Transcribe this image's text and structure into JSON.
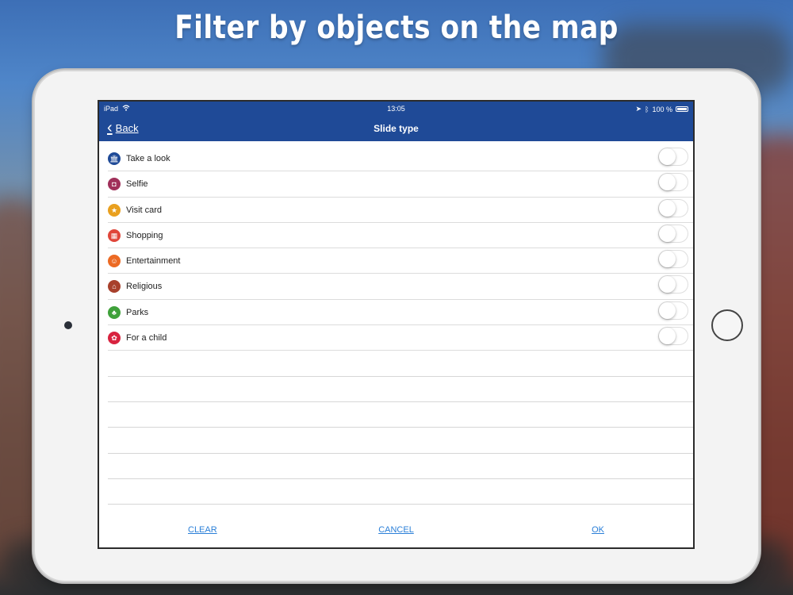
{
  "headline": "Filter by objects on the map",
  "status": {
    "device": "iPad",
    "time": "13:05",
    "battery": "100 %"
  },
  "navbar": {
    "back_label": "Back",
    "title": "Slide type"
  },
  "items": [
    {
      "label": "Take a look",
      "icon": "museum-icon",
      "color": "#1f4a97",
      "glyph": "🏛",
      "on": false
    },
    {
      "label": "Selfie",
      "icon": "camera-icon",
      "color": "#a0305a",
      "glyph": "◘",
      "on": false
    },
    {
      "label": "Visit card",
      "icon": "star-icon",
      "color": "#e9a01f",
      "glyph": "★",
      "on": false
    },
    {
      "label": "Shopping",
      "icon": "shopping-cart-icon",
      "color": "#e0463a",
      "glyph": "▦",
      "on": false
    },
    {
      "label": "Entertainment",
      "icon": "smiley-icon",
      "color": "#ec6a24",
      "glyph": "☺",
      "on": false
    },
    {
      "label": "Religious",
      "icon": "church-icon",
      "color": "#a8402c",
      "glyph": "⌂",
      "on": false
    },
    {
      "label": "Parks",
      "icon": "tree-icon",
      "color": "#3fa13a",
      "glyph": "♣",
      "on": false
    },
    {
      "label": "For a child",
      "icon": "duck-icon",
      "color": "#d8233f",
      "glyph": "✿",
      "on": false
    }
  ],
  "footer": {
    "clear": "CLEAR",
    "cancel": "CANCEL",
    "ok": "OK"
  }
}
